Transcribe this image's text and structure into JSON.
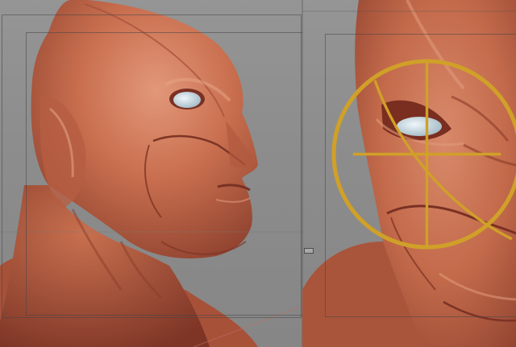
{
  "scene": {
    "views": [
      {
        "label": "side-profile-view"
      },
      {
        "label": "front-closeup-view"
      }
    ],
    "colors": {
      "background": "#8d8d8d",
      "clay": "#c8704f",
      "clay_shadow": "#8e3f2d",
      "clay_highlight": "#e5a07f",
      "eye": "#cfe0e8",
      "gizmo": "#d0a028"
    },
    "icons": [
      "navigation-gizmo-icon",
      "viewport-splitter-handle-icon"
    ]
  }
}
